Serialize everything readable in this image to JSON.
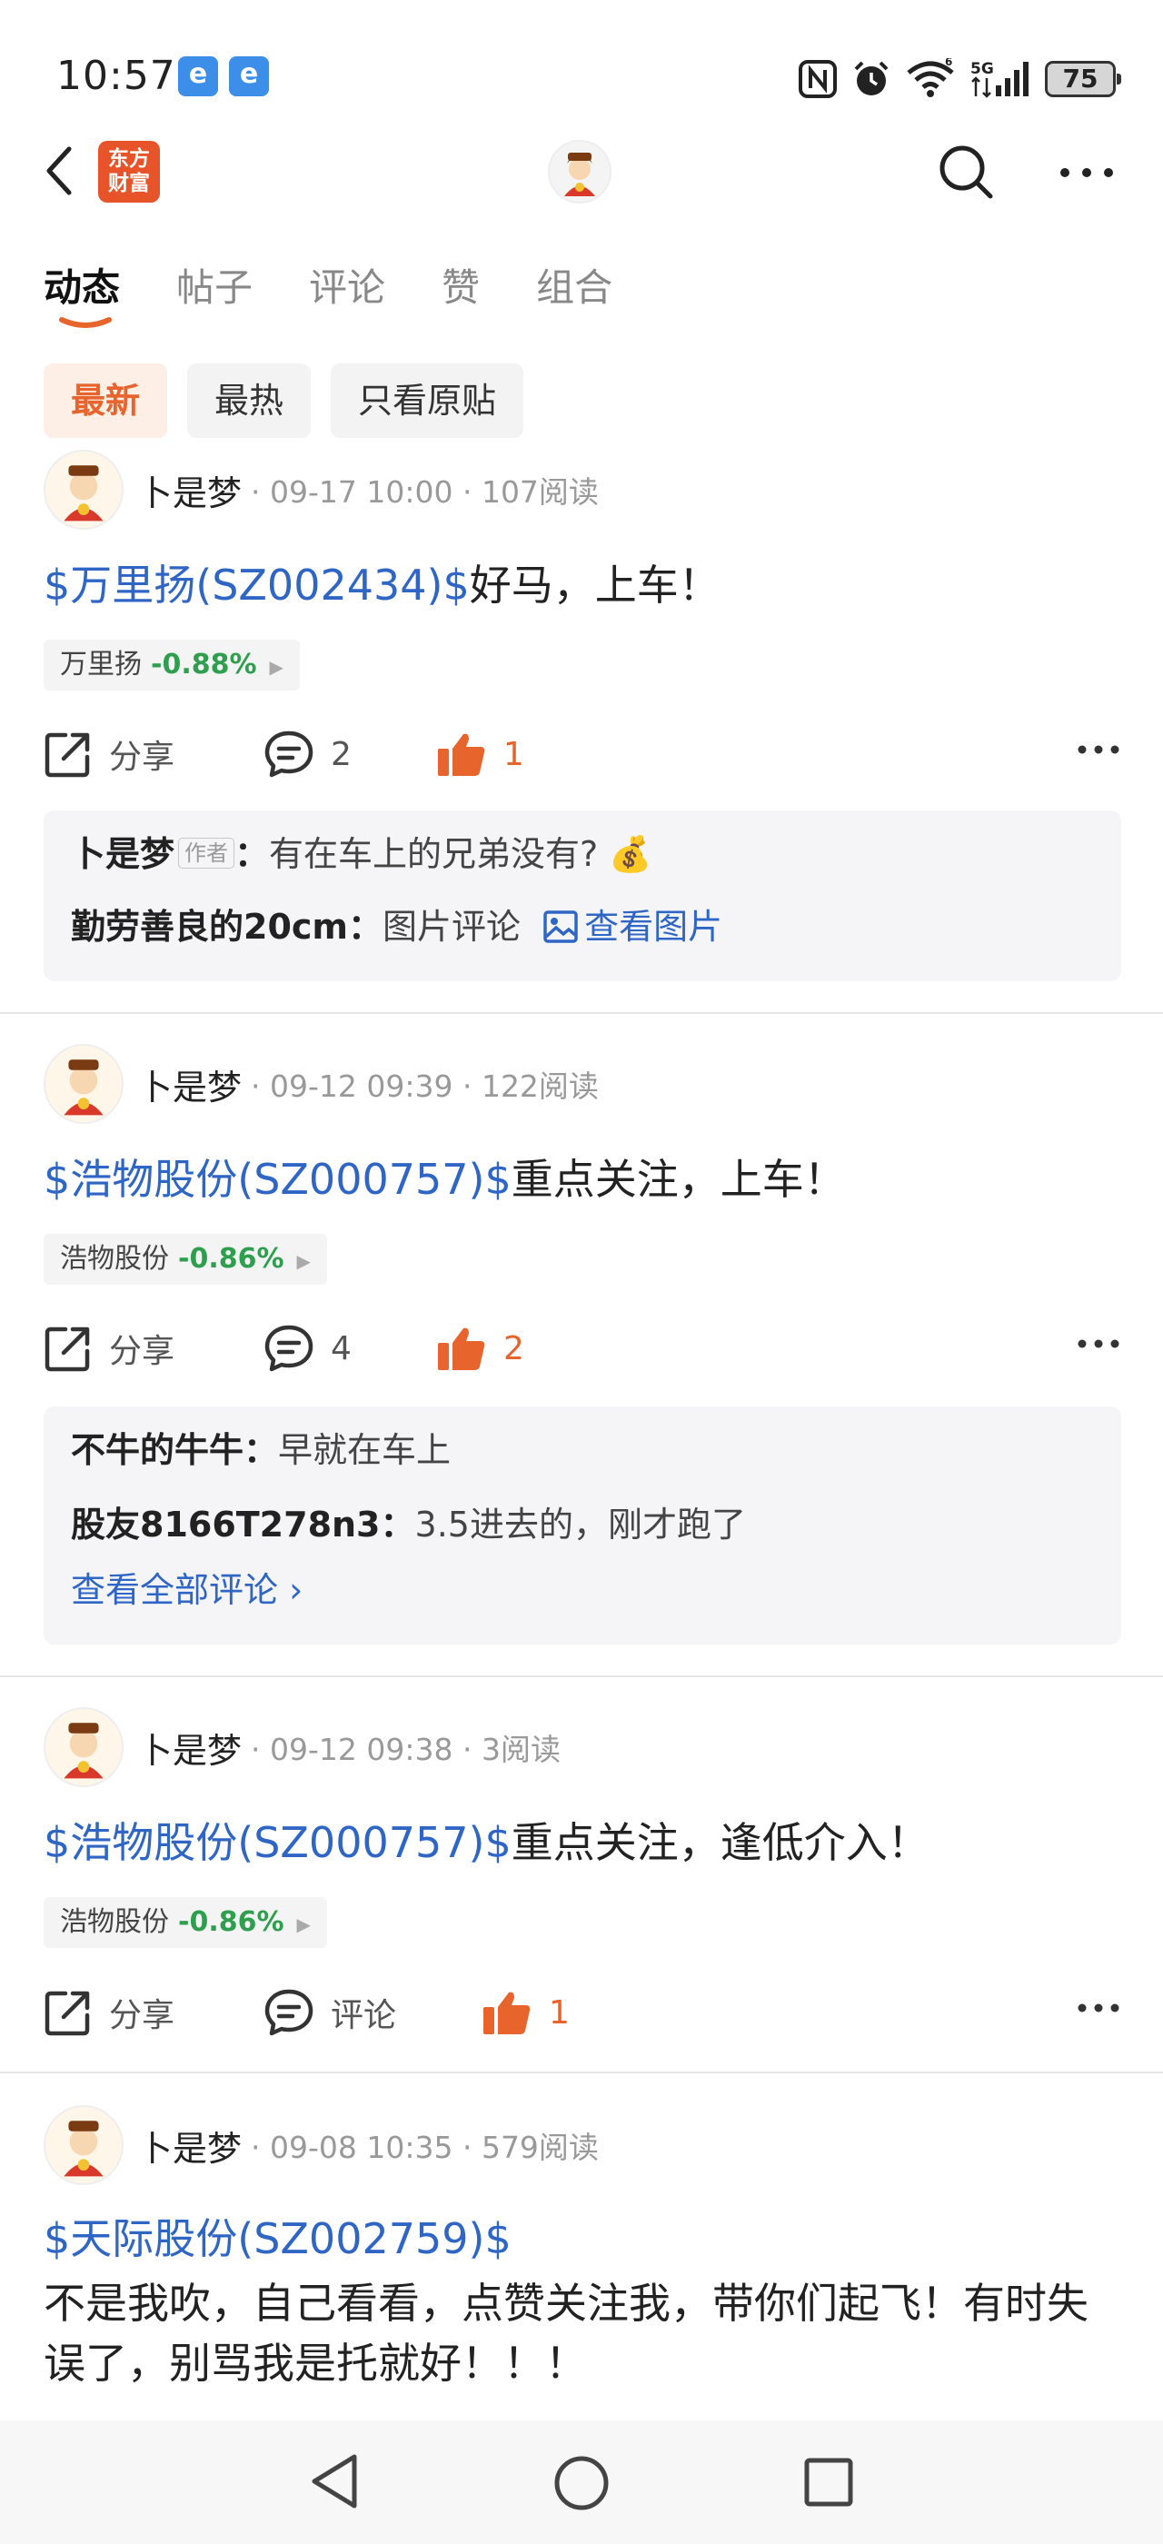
{
  "status_bar": {
    "time": "10:57",
    "notification_icons": [
      "e",
      "e"
    ],
    "system_icons": [
      "nfc-icon",
      "alarm-icon",
      "wifi-icon",
      "cellular-5g-icon"
    ],
    "battery": "75"
  },
  "header": {
    "app_logo_line1": "东方",
    "app_logo_line2": "财富"
  },
  "tabs": [
    {
      "label": "动态",
      "active": true
    },
    {
      "label": "帖子",
      "active": false
    },
    {
      "label": "评论",
      "active": false
    },
    {
      "label": "赞",
      "active": false
    },
    {
      "label": "组合",
      "active": false
    }
  ],
  "filters": [
    {
      "label": "最新",
      "active": true
    },
    {
      "label": "最热",
      "active": false
    },
    {
      "label": "只看原贴",
      "active": false
    }
  ],
  "posts": [
    {
      "author": "卜是梦",
      "meta": "· 09-17 10:00 · 107阅读",
      "stock_link": "$万里扬(SZ002434)$",
      "text": "好马，上车！",
      "stock_tag_name": "万里扬",
      "stock_tag_change": "-0.88%",
      "share_label": "分享",
      "comment_label": "2",
      "like_count": "1",
      "comments": [
        {
          "name": "卜是梦",
          "badge": "作者",
          "text": "有在车上的兄弟没有? 💰"
        },
        {
          "name": "勤劳善良的20cm",
          "text": "图片评论",
          "link": "查看图片"
        }
      ]
    },
    {
      "author": "卜是梦",
      "meta": "· 09-12 09:39 · 122阅读",
      "stock_link": "$浩物股份(SZ000757)$",
      "text": "重点关注，上车！",
      "stock_tag_name": "浩物股份",
      "stock_tag_change": "-0.86%",
      "share_label": "分享",
      "comment_label": "4",
      "like_count": "2",
      "comments": [
        {
          "name": "不牛的牛牛",
          "text": "早就在车上"
        },
        {
          "name": "股友8166T278n3",
          "text": "3.5进去的，刚才跑了"
        }
      ],
      "view_all": "查看全部评论 ›"
    },
    {
      "author": "卜是梦",
      "meta": "· 09-12 09:38 · 3阅读",
      "stock_link": "$浩物股份(SZ000757)$",
      "text": "重点关注，逢低介入！",
      "stock_tag_name": "浩物股份",
      "stock_tag_change": "-0.86%",
      "share_label": "分享",
      "comment_label": "评论",
      "like_count": "1"
    },
    {
      "author": "卜是梦",
      "meta": "· 09-08 10:35 · 579阅读",
      "stock_link": "$天际股份(SZ002759)$",
      "text": "不是我吹，自己看看，点赞关注我，带你们起飞！有时失误了，别骂我是托就好！！！"
    }
  ],
  "colors": {
    "accent": "#e7642c",
    "link": "#2f66c5",
    "stock_down": "#2f9e4f"
  }
}
